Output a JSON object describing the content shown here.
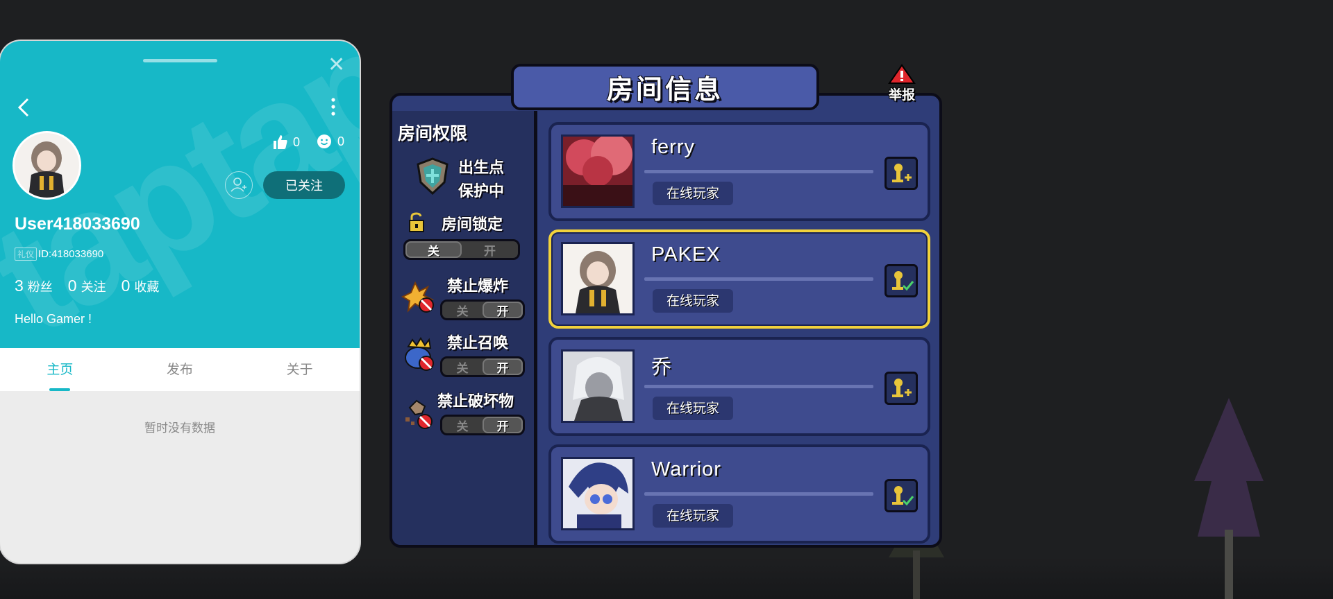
{
  "profile": {
    "username": "User418033690",
    "id_tag": "礼仪",
    "id_text": "ID:418033690",
    "likes": "0",
    "smiles": "0",
    "follow_label": "已关注",
    "stats": [
      {
        "count": "3",
        "label": "粉丝"
      },
      {
        "count": "0",
        "label": "关注"
      },
      {
        "count": "0",
        "label": "收藏"
      }
    ],
    "bio": "Hello Gamer !",
    "tabs": [
      "主页",
      "发布",
      "关于"
    ],
    "empty_text": "暂时没有数据",
    "accent_color": "#17b8c7"
  },
  "room": {
    "title": "房间信息",
    "report_label": "举报",
    "permissions_title": "房间权限",
    "spawn_protect": [
      "出生点",
      "保护中"
    ],
    "lock": {
      "label": "房间锁定",
      "off": "关",
      "on": "开",
      "state": "off"
    },
    "no_explosion": {
      "label": "禁止爆炸",
      "off": "关",
      "on": "开",
      "state": "on"
    },
    "no_summon": {
      "label": "禁止召唤",
      "off": "关",
      "on": "开",
      "state": "on"
    },
    "no_destroy": {
      "label": "禁止破坏物",
      "off": "关",
      "on": "开",
      "state": "on"
    },
    "players": [
      {
        "name": "ferry",
        "status": "在线玩家",
        "action": "add-friend-icon",
        "selected": false
      },
      {
        "name": "PAKEX",
        "status": "在线玩家",
        "action": "friend-check-icon",
        "selected": true
      },
      {
        "name": "乔",
        "status": "在线玩家",
        "action": "add-friend-icon",
        "selected": false
      },
      {
        "name": "Warrior",
        "status": "在线玩家",
        "action": "friend-check-icon",
        "selected": false
      }
    ]
  }
}
